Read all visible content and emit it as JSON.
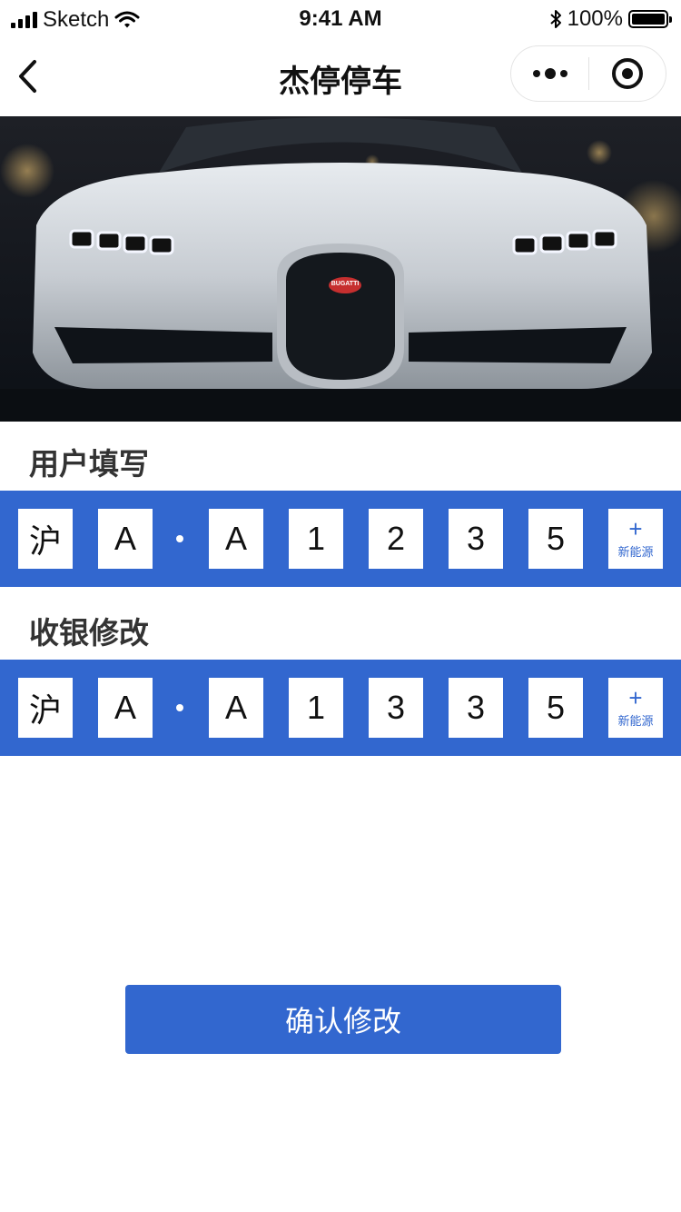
{
  "status_bar": {
    "carrier": "Sketch",
    "time": "9:41 AM",
    "battery": "100%"
  },
  "nav": {
    "title": "杰停停车"
  },
  "hero": {
    "badge": "BUGATTI"
  },
  "user_section": {
    "title": "用户填写",
    "plate": [
      "沪",
      "A",
      "A",
      "1",
      "2",
      "3",
      "5"
    ],
    "new_energy_label": "新能源"
  },
  "cashier_section": {
    "title": "收银修改",
    "plate": [
      "沪",
      "A",
      "A",
      "1",
      "3",
      "3",
      "5"
    ],
    "new_energy_label": "新能源"
  },
  "confirm_button": "确认修改",
  "colors": {
    "accent": "#3267cf"
  }
}
